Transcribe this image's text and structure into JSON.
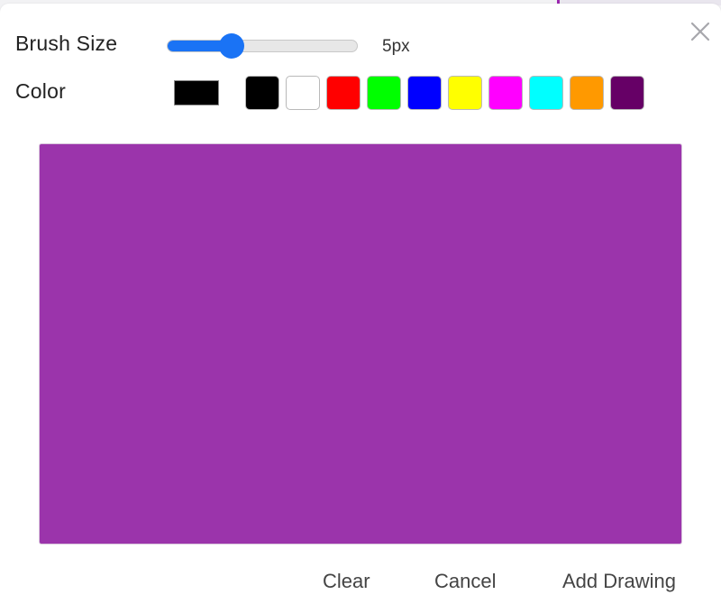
{
  "brush": {
    "label": "Brush Size",
    "value_text": "5px",
    "slider_fraction": 0.34
  },
  "color": {
    "label": "Color",
    "current": "#000000",
    "swatches": [
      {
        "name": "black",
        "hex": "#000000"
      },
      {
        "name": "white",
        "hex": "#ffffff"
      },
      {
        "name": "red",
        "hex": "#ff0000"
      },
      {
        "name": "green",
        "hex": "#00ff00"
      },
      {
        "name": "blue",
        "hex": "#0000ff"
      },
      {
        "name": "yellow",
        "hex": "#ffff00"
      },
      {
        "name": "magenta",
        "hex": "#ff00ff"
      },
      {
        "name": "cyan",
        "hex": "#00ffff"
      },
      {
        "name": "orange",
        "hex": "#ff9900"
      },
      {
        "name": "purple",
        "hex": "#660066"
      }
    ]
  },
  "canvas": {
    "background": "#9b34ab"
  },
  "icons": {
    "close": "close-icon"
  },
  "footer": {
    "clear_label": "Clear",
    "cancel_label": "Cancel",
    "add_label": "Add Drawing"
  }
}
